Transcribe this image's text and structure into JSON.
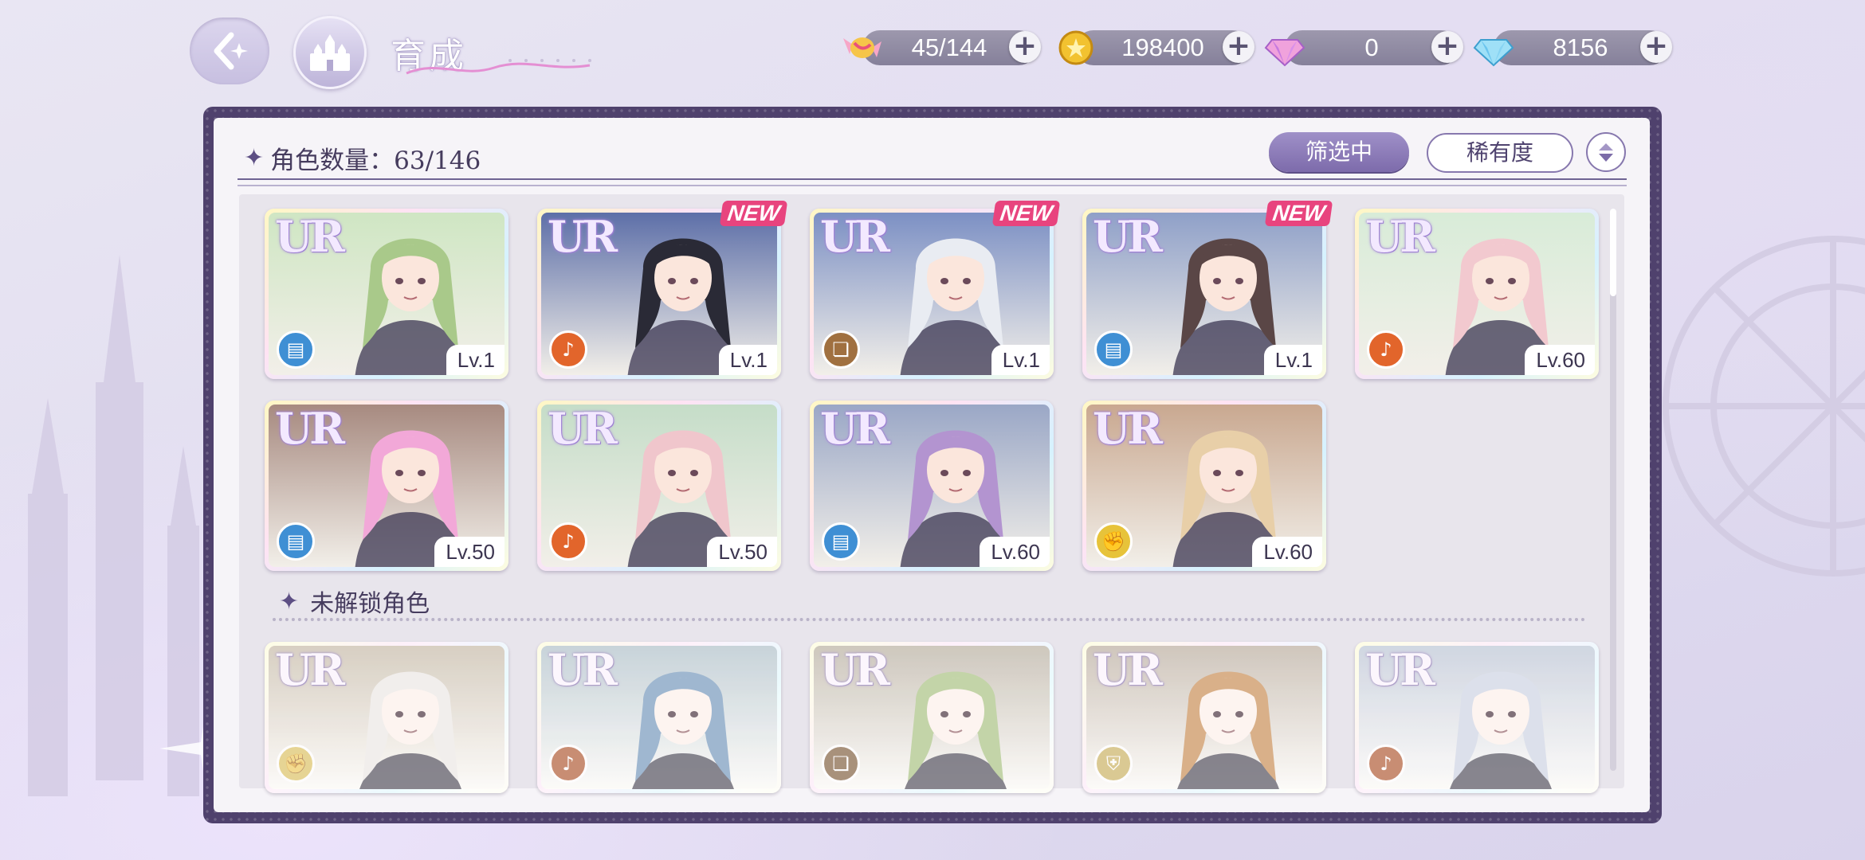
{
  "header": {
    "title": "育成",
    "currencies": [
      {
        "icon": "candy-icon",
        "value": "45/144"
      },
      {
        "icon": "gold-coin-icon",
        "value": "198400"
      },
      {
        "icon": "pink-gem-icon",
        "value": "0"
      },
      {
        "icon": "blue-diamond-icon",
        "value": "8156"
      }
    ]
  },
  "panel": {
    "count_label": "角色数量：63/146",
    "filter_label": "筛选中",
    "rarity_label": "稀有度",
    "unlocked_section_label": "未解锁角色"
  },
  "cards": [
    {
      "rarity": "UR",
      "level": "Lv.1",
      "element": "book",
      "new": "",
      "hair": "#a9c98a",
      "bg": "#cfe6c3"
    },
    {
      "rarity": "UR",
      "level": "Lv.1",
      "element": "mic",
      "new": "NEW",
      "hair": "#2a2a36",
      "bg": "#5d6fa8"
    },
    {
      "rarity": "UR",
      "level": "Lv.1",
      "element": "cards",
      "new": "NEW",
      "hair": "#e9ecf2",
      "bg": "#7c90c4"
    },
    {
      "rarity": "UR",
      "level": "Lv.1",
      "element": "book",
      "new": "NEW",
      "hair": "#5a4646",
      "bg": "#8fa0c8"
    },
    {
      "rarity": "UR",
      "level": "Lv.60",
      "element": "mic",
      "new": "",
      "hair": "#f2c9cf",
      "bg": "#d8ecd8"
    },
    {
      "rarity": "UR",
      "level": "Lv.50",
      "element": "book",
      "new": "",
      "hair": "#f2a8d8",
      "bg": "#a78a80"
    },
    {
      "rarity": "UR",
      "level": "Lv.50",
      "element": "mic",
      "new": "",
      "hair": "#f0c6cc",
      "bg": "#c5ddc8"
    },
    {
      "rarity": "UR",
      "level": "Lv.60",
      "element": "book",
      "new": "",
      "hair": "#b394d0",
      "bg": "#9aa7c6"
    },
    {
      "rarity": "UR",
      "level": "Lv.60",
      "element": "fist",
      "new": "",
      "hair": "#e8cfa8",
      "bg": "#c9a890"
    }
  ],
  "locked_cards": [
    {
      "rarity": "UR",
      "element": "fist",
      "hair": "#e6e0da",
      "bg": "#cdbb9f"
    },
    {
      "rarity": "UR",
      "element": "mic",
      "hair": "#6fa3d8",
      "bg": "#aac3cf"
    },
    {
      "rarity": "UR",
      "element": "cards",
      "hair": "#a3c96a",
      "bg": "#c0b39c"
    },
    {
      "rarity": "UR",
      "element": "shield",
      "hair": "#e9923d",
      "bg": "#c4b19b"
    },
    {
      "rarity": "UR",
      "element": "mic",
      "hair": "#c9d0e6",
      "bg": "#b8c5dc"
    }
  ],
  "element_colors": {
    "book": "#3f8fd4",
    "mic": "#e2652b",
    "cards": "#a07040",
    "fist": "#e7c33a",
    "shield": "#d9b640"
  }
}
